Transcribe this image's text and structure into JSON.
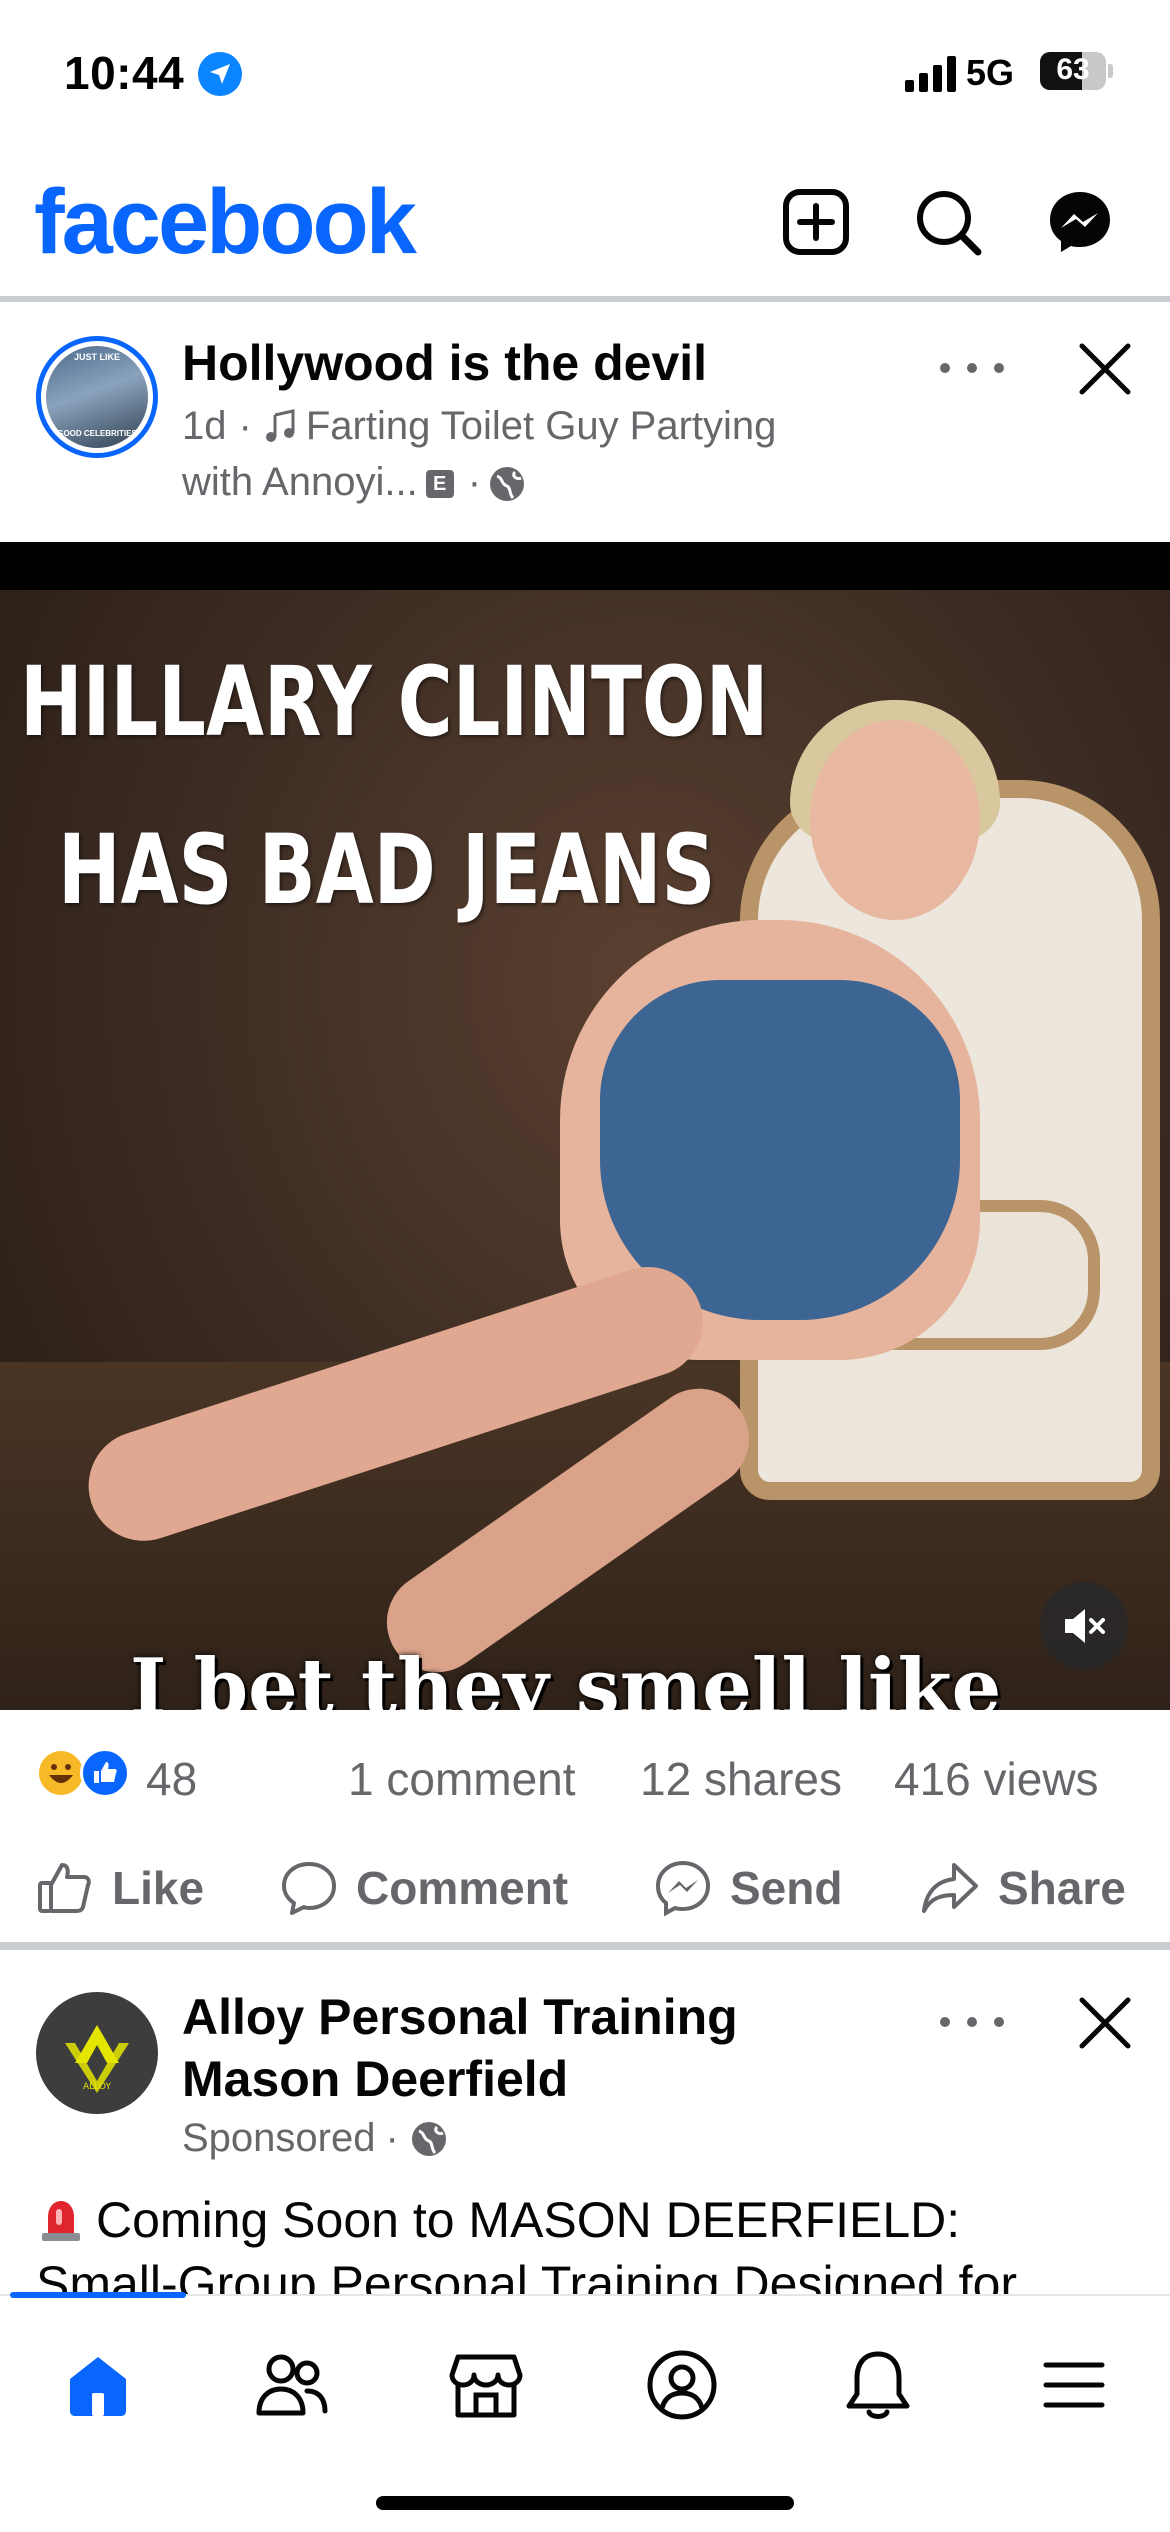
{
  "status_bar": {
    "time": "10:44",
    "network": "5G",
    "battery": "63",
    "battery_level": 0.63
  },
  "app": {
    "logo": "facebook",
    "brand_color": "#0866ff",
    "header_icons": [
      "add-post-icon",
      "search-icon",
      "messenger-icon"
    ]
  },
  "post1": {
    "author": "Hollywood is the devil",
    "avatar_caption_top": "JUST LIKE",
    "avatar_caption_bottom": "GOOD CELEBRITIES",
    "time": "1d",
    "audio": "Farting Toilet Guy Partying",
    "audio_cont": "with Annoyi...",
    "badge": "E",
    "meme_line1": "HILLARY CLINTON",
    "meme_line2": "HAS BAD JEANS",
    "meme_line3": "I bet they smell like",
    "reactions": "48",
    "comments": "1 comment",
    "shares": "12 shares",
    "views": "416 views",
    "actions": {
      "like": "Like",
      "comment": "Comment",
      "send": "Send",
      "share": "Share"
    }
  },
  "post2": {
    "author_line1": "Alloy Personal Training",
    "author_line2": "Mason Deerfield",
    "sponsored": "Sponsored",
    "avatar_text": "ALLOY",
    "text_line1": "Coming Soon to MASON DEERFIELD:",
    "text_line2": "Small-Group Personal Training Designed for"
  },
  "bottom_nav": [
    "home-icon",
    "friends-icon",
    "marketplace-icon",
    "profile-icon",
    "notifications-icon",
    "menu-icon"
  ]
}
